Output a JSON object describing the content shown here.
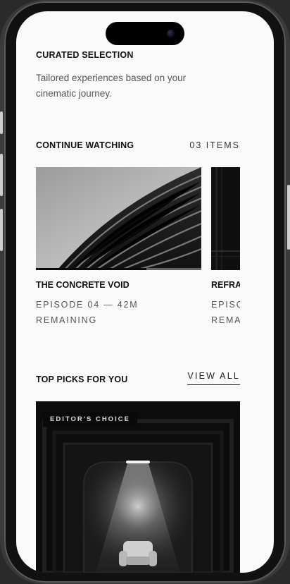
{
  "curated": {
    "title": "CURATED SELECTION",
    "subtitle": "Tailored experiences based on your cinematic journey."
  },
  "continue_watching": {
    "title": "CONTINUE WATCHING",
    "count_label": "03 ITEMS",
    "items": [
      {
        "title": "THE CONCRETE VOID",
        "meta": "EPISODE 04 — 42M REMAINING",
        "progress": 0.67
      },
      {
        "title": "REFRA",
        "meta": "EPISC REMA",
        "progress": 0.3
      }
    ]
  },
  "top_picks": {
    "title": "TOP PICKS FOR YOU",
    "view_all_label": "VIEW ALL",
    "feature": {
      "badge": "EDITOR'S CHOICE"
    }
  },
  "colors": {
    "background": "#fafafa",
    "text": "#111111",
    "muted": "#555555",
    "accent": "#0a0a0a"
  }
}
